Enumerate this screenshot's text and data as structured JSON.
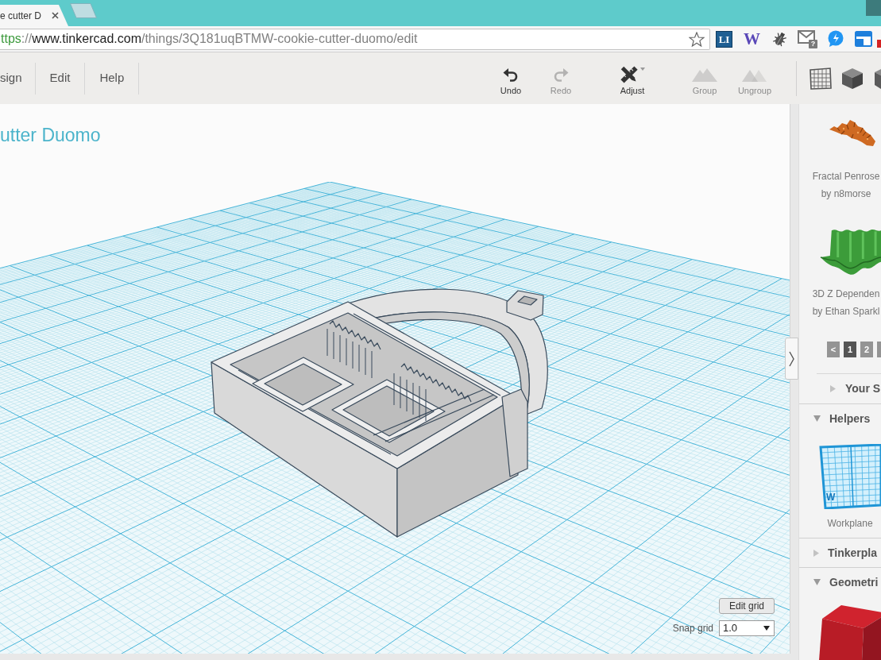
{
  "browser": {
    "tabs": [
      {
        "title": "e cutter D",
        "selected": true
      }
    ],
    "url": {
      "scheme": "ttps",
      "separator": "://",
      "host": "www.tinkercad.com",
      "path": "/things/3Q181uqBTMW-cookie-cutter-duomo/edit"
    },
    "extensions": [
      {
        "kind": "tile",
        "label": "LI"
      },
      {
        "kind": "serif",
        "label": "W"
      },
      {
        "kind": "bug"
      },
      {
        "kind": "mail",
        "badge": "?"
      },
      {
        "kind": "chat"
      },
      {
        "kind": "window"
      },
      {
        "kind": "edge"
      }
    ]
  },
  "menu": [
    "sign",
    "Edit",
    "Help"
  ],
  "tools": [
    {
      "kind": "undo",
      "label": "Undo",
      "disabled": false
    },
    {
      "kind": "redo",
      "label": "Redo",
      "disabled": true
    },
    {
      "kind": "adjust",
      "label": "Adjust",
      "disabled": false
    },
    {
      "kind": "group",
      "label": "Group",
      "disabled": true
    },
    {
      "kind": "ungroup",
      "label": "Ungroup",
      "disabled": true
    }
  ],
  "view_tools": [
    {
      "kind": "grid"
    },
    {
      "kind": "cube"
    },
    {
      "kind": "edge-cube"
    }
  ],
  "design": {
    "title": "utter Duomo",
    "edit_grid": "Edit grid",
    "snap_label": "Snap grid",
    "snap_value": "1.0"
  },
  "sidebar": {
    "gallery": [
      {
        "kind": "fractal",
        "title": "Fractal Penrose",
        "author": "by n8morse"
      },
      {
        "kind": "wave",
        "title": "3D Z Dependen",
        "author": "by Ethan Sparkl"
      }
    ],
    "pages": [
      {
        "label": "<",
        "selected": false
      },
      {
        "label": "1",
        "selected": true
      },
      {
        "label": "2",
        "selected": false
      },
      {
        "selected": false
      }
    ],
    "subsection": {
      "title": "Your S",
      "expanded": false
    },
    "sections": [
      {
        "title": "Helpers",
        "expanded": true,
        "items": [
          {
            "kind": "workplane",
            "label": "Workplane",
            "badge": "W"
          }
        ]
      },
      {
        "title": "Tinkerpla",
        "expanded": false
      },
      {
        "title": "Geometri",
        "expanded": true,
        "items": [
          {
            "kind": "box"
          }
        ]
      }
    ]
  }
}
